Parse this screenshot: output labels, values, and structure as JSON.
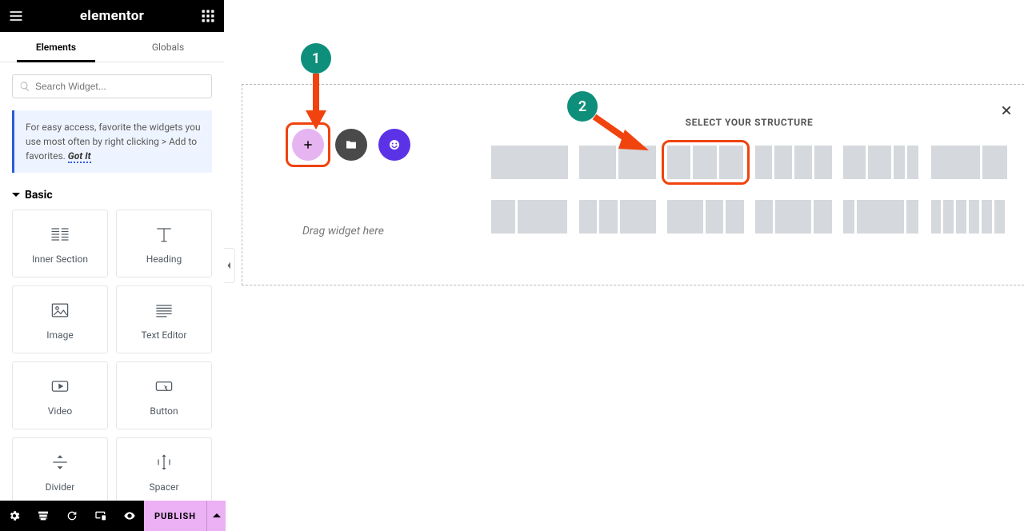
{
  "header": {
    "brand": "elementor"
  },
  "tabs": {
    "elements": "Elements",
    "globals": "Globals"
  },
  "search": {
    "placeholder": "Search Widget..."
  },
  "tip": {
    "text": "For easy access, favorite the widgets you use most often by right clicking > Add to favorites. ",
    "link": "Got It"
  },
  "category": {
    "basic": "Basic"
  },
  "widgets": [
    {
      "name": "inner-section",
      "label": "Inner Section"
    },
    {
      "name": "heading",
      "label": "Heading"
    },
    {
      "name": "image",
      "label": "Image"
    },
    {
      "name": "text-editor",
      "label": "Text Editor"
    },
    {
      "name": "video",
      "label": "Video"
    },
    {
      "name": "button",
      "label": "Button"
    },
    {
      "name": "divider",
      "label": "Divider"
    },
    {
      "name": "spacer",
      "label": "Spacer"
    }
  ],
  "footer": {
    "publish": "PUBLISH"
  },
  "canvas": {
    "drag_hint": "Drag widget here",
    "structure_title": "SELECT YOUR STRUCTURE",
    "structures": [
      [
        100
      ],
      [
        50,
        50
      ],
      [
        33,
        33,
        33
      ],
      [
        25,
        25,
        25,
        25
      ],
      [
        33,
        33,
        16,
        16
      ],
      [
        66,
        33
      ],
      [
        33,
        66
      ],
      [
        25,
        25,
        50
      ],
      [
        50,
        25,
        25
      ],
      [
        25,
        50,
        25
      ],
      [
        16,
        66,
        16
      ],
      [
        16,
        16,
        16,
        16,
        16,
        16
      ]
    ],
    "highlight_index": 2
  },
  "annotations": {
    "step1": "1",
    "step2": "2"
  },
  "colors": {
    "accent_orange": "#f0430e",
    "accent_teal": "#0d8f7b"
  }
}
